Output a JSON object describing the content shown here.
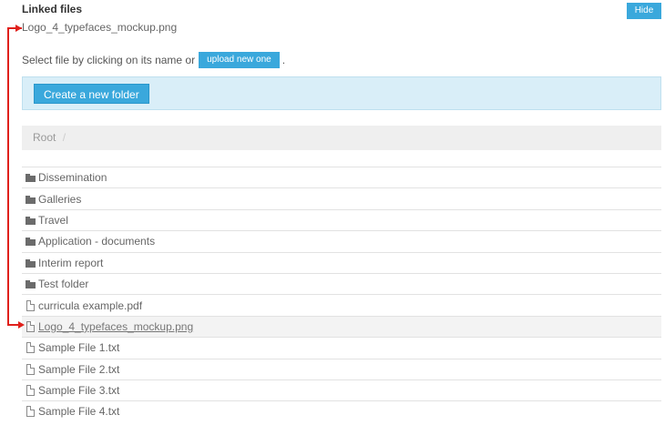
{
  "header": {
    "title": "Linked files",
    "hide_label": "Hide"
  },
  "linked_file": "Logo_4_typefaces_mockup.png",
  "select": {
    "text": "Select file by clicking on its name or",
    "upload_label": "upload new one",
    "period": "."
  },
  "folder_panel": {
    "create_label": "Create a new folder"
  },
  "breadcrumb": {
    "root": "Root",
    "separator": "/"
  },
  "items": [
    {
      "type": "folder",
      "name": "Dissemination"
    },
    {
      "type": "folder",
      "name": "Galleries"
    },
    {
      "type": "folder",
      "name": "Travel"
    },
    {
      "type": "folder",
      "name": "Application - documents"
    },
    {
      "type": "folder",
      "name": "Interim report"
    },
    {
      "type": "folder",
      "name": "Test folder"
    },
    {
      "type": "file",
      "name": "curricula example.pdf"
    },
    {
      "type": "file",
      "name": "Logo_4_typefaces_mockup.png",
      "selected": true
    },
    {
      "type": "file",
      "name": "Sample File 1.txt"
    },
    {
      "type": "file",
      "name": "Sample File 2.txt"
    },
    {
      "type": "file",
      "name": "Sample File 3.txt"
    },
    {
      "type": "file",
      "name": "Sample File 4.txt"
    }
  ],
  "colors": {
    "accent": "#3aa8dc",
    "panel": "#d9eef8",
    "annotation": "#e0201b"
  }
}
